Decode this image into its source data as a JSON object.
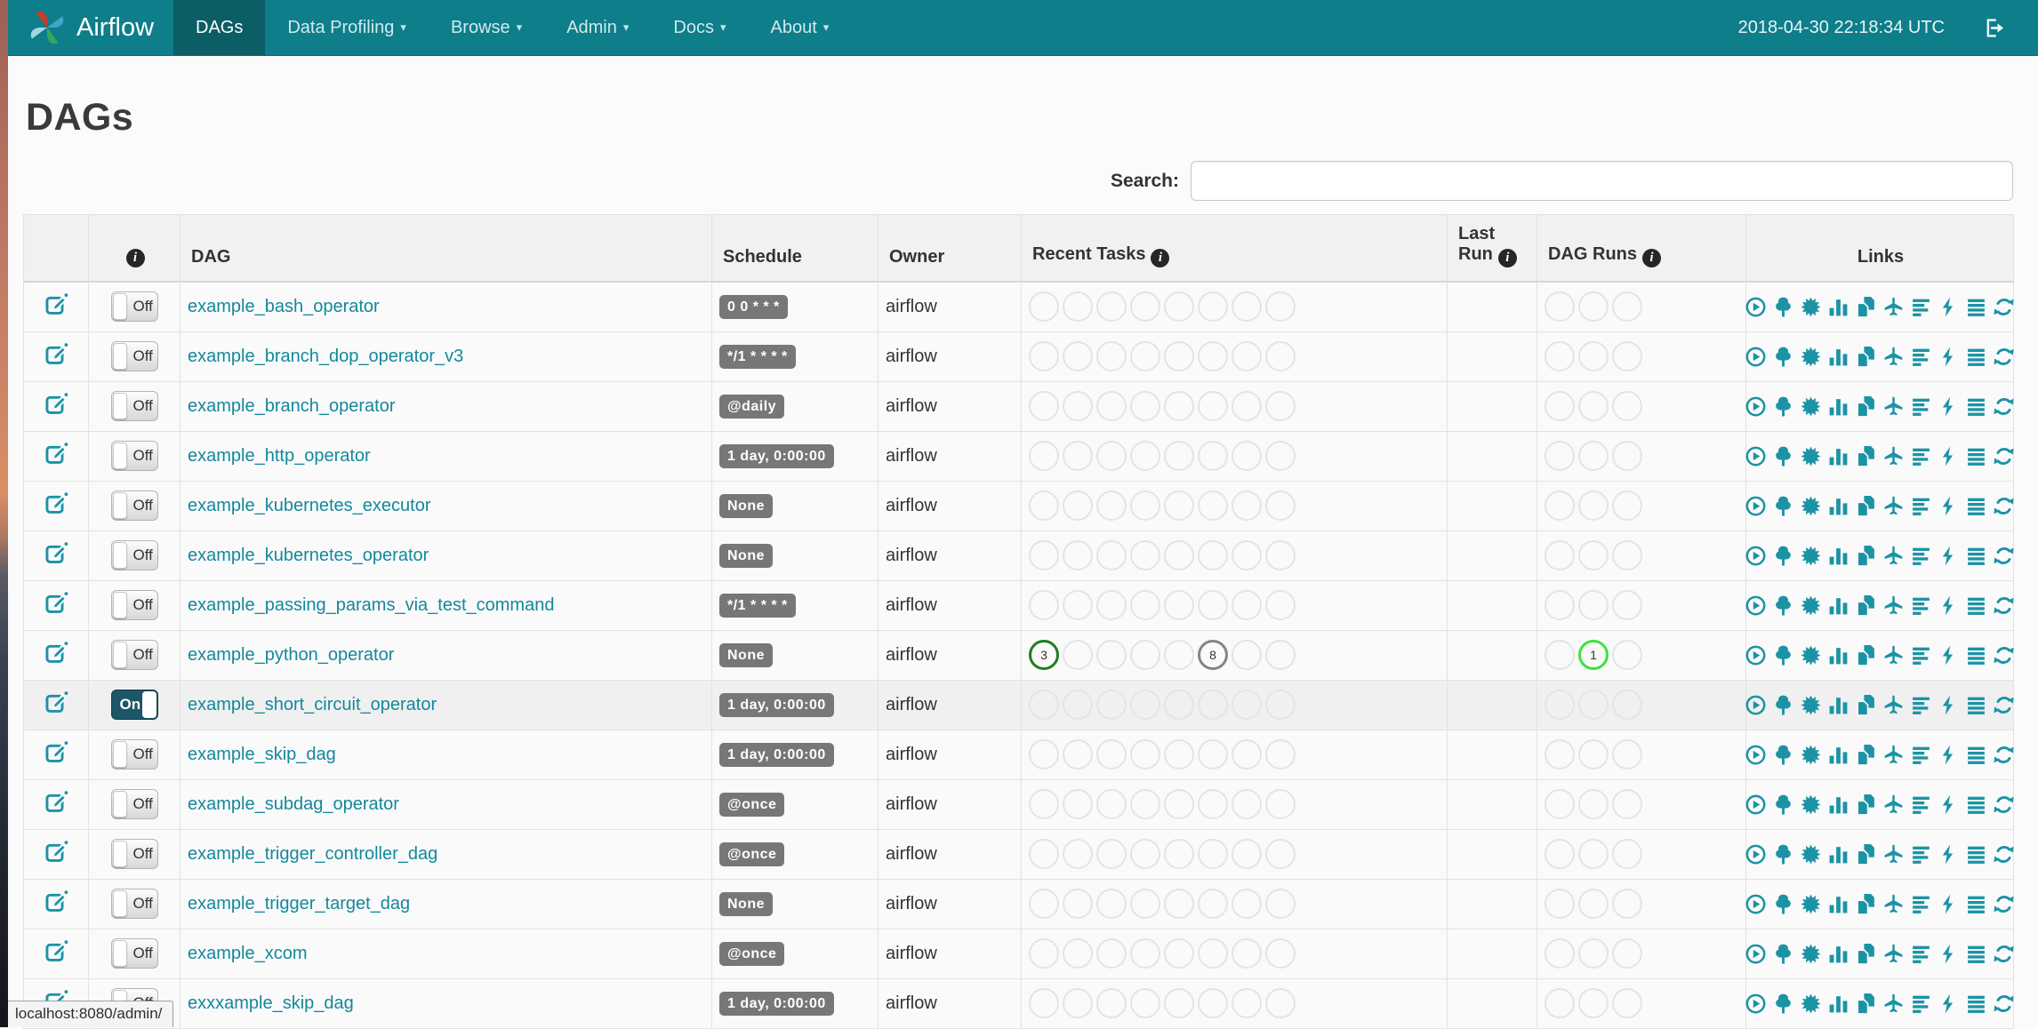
{
  "navbar": {
    "brand": "Airflow",
    "items": [
      {
        "label": "DAGs",
        "active": true,
        "caret": false
      },
      {
        "label": "Data Profiling",
        "active": false,
        "caret": true
      },
      {
        "label": "Browse",
        "active": false,
        "caret": true
      },
      {
        "label": "Admin",
        "active": false,
        "caret": true
      },
      {
        "label": "Docs",
        "active": false,
        "caret": true
      },
      {
        "label": "About",
        "active": false,
        "caret": true
      }
    ],
    "clock": "2018-04-30 22:18:34 UTC"
  },
  "page": {
    "title": "DAGs"
  },
  "search": {
    "label": "Search:",
    "value": ""
  },
  "table": {
    "info_glyph": "i",
    "headers": {
      "edit": "",
      "dag": "DAG",
      "schedule": "Schedule",
      "owner": "Owner",
      "recent_tasks": "Recent Tasks",
      "last_run": "Last Run",
      "dag_runs": "DAG Runs",
      "links": "Links"
    },
    "toggle": {
      "on_label": "On",
      "off_label": "Off"
    },
    "recent_task_slots": 8,
    "dag_run_slots": 3,
    "circle_colors": {
      "green": "#1e7e1e",
      "gray": "#858585",
      "lime": "#3be33b",
      "empty": "#e4e4e4"
    },
    "links_icons": [
      "trigger-dag-icon",
      "tree-view-icon",
      "graph-view-icon",
      "task-duration-icon",
      "task-tries-icon",
      "landing-times-icon",
      "gantt-icon",
      "code-view-icon",
      "logs-icon",
      "refresh-icon"
    ],
    "rows": [
      {
        "dag": "example_bash_operator",
        "schedule": "0 0 * * *",
        "owner": "airflow",
        "paused": true,
        "hovered": false,
        "last_run": "",
        "recent_task_marks": [],
        "dag_run_marks": []
      },
      {
        "dag": "example_branch_dop_operator_v3",
        "schedule": "*/1 * * * *",
        "owner": "airflow",
        "paused": true,
        "hovered": false,
        "last_run": "",
        "recent_task_marks": [],
        "dag_run_marks": []
      },
      {
        "dag": "example_branch_operator",
        "schedule": "@daily",
        "owner": "airflow",
        "paused": true,
        "hovered": false,
        "last_run": "",
        "recent_task_marks": [],
        "dag_run_marks": []
      },
      {
        "dag": "example_http_operator",
        "schedule": "1 day, 0:00:00",
        "owner": "airflow",
        "paused": true,
        "hovered": false,
        "last_run": "",
        "recent_task_marks": [],
        "dag_run_marks": []
      },
      {
        "dag": "example_kubernetes_executor",
        "schedule": "None",
        "owner": "airflow",
        "paused": true,
        "hovered": false,
        "last_run": "",
        "recent_task_marks": [],
        "dag_run_marks": []
      },
      {
        "dag": "example_kubernetes_operator",
        "schedule": "None",
        "owner": "airflow",
        "paused": true,
        "hovered": false,
        "last_run": "",
        "recent_task_marks": [],
        "dag_run_marks": []
      },
      {
        "dag": "example_passing_params_via_test_command",
        "schedule": "*/1 * * * *",
        "owner": "airflow",
        "paused": true,
        "hovered": false,
        "last_run": "",
        "recent_task_marks": [],
        "dag_run_marks": []
      },
      {
        "dag": "example_python_operator",
        "schedule": "None",
        "owner": "airflow",
        "paused": true,
        "hovered": false,
        "last_run": "",
        "recent_task_marks": [
          {
            "pos": 0,
            "count": 3,
            "color": "green"
          },
          {
            "pos": 5,
            "count": 8,
            "color": "gray"
          }
        ],
        "dag_run_marks": [
          {
            "pos": 1,
            "count": 1,
            "color": "lime"
          }
        ]
      },
      {
        "dag": "example_short_circuit_operator",
        "schedule": "1 day, 0:00:00",
        "owner": "airflow",
        "paused": false,
        "hovered": true,
        "last_run": "",
        "recent_task_marks": [],
        "dag_run_marks": []
      },
      {
        "dag": "example_skip_dag",
        "schedule": "1 day, 0:00:00",
        "owner": "airflow",
        "paused": true,
        "hovered": false,
        "last_run": "",
        "recent_task_marks": [],
        "dag_run_marks": []
      },
      {
        "dag": "example_subdag_operator",
        "schedule": "@once",
        "owner": "airflow",
        "paused": true,
        "hovered": false,
        "last_run": "",
        "recent_task_marks": [],
        "dag_run_marks": []
      },
      {
        "dag": "example_trigger_controller_dag",
        "schedule": "@once",
        "owner": "airflow",
        "paused": true,
        "hovered": false,
        "last_run": "",
        "recent_task_marks": [],
        "dag_run_marks": []
      },
      {
        "dag": "example_trigger_target_dag",
        "schedule": "None",
        "owner": "airflow",
        "paused": true,
        "hovered": false,
        "last_run": "",
        "recent_task_marks": [],
        "dag_run_marks": []
      },
      {
        "dag": "example_xcom",
        "schedule": "@once",
        "owner": "airflow",
        "paused": true,
        "hovered": false,
        "last_run": "",
        "recent_task_marks": [],
        "dag_run_marks": []
      },
      {
        "dag": "exxxample_skip_dag",
        "schedule": "1 day, 0:00:00",
        "owner": "airflow",
        "paused": true,
        "hovered": false,
        "last_run": "",
        "recent_task_marks": [],
        "dag_run_marks": []
      }
    ]
  },
  "statusbar": {
    "text": "localhost:8080/admin/"
  },
  "colors": {
    "navbar": "#0d7e8a",
    "navbar_active": "#0b5d66",
    "accent": "#1b93a5",
    "link": "#14889b",
    "badge": "#777777",
    "toggle_on": "#1b5766",
    "logo": [
      "#cc3a28",
      "#3fa7c4",
      "#3aa65c",
      "#9fd6e2"
    ]
  }
}
